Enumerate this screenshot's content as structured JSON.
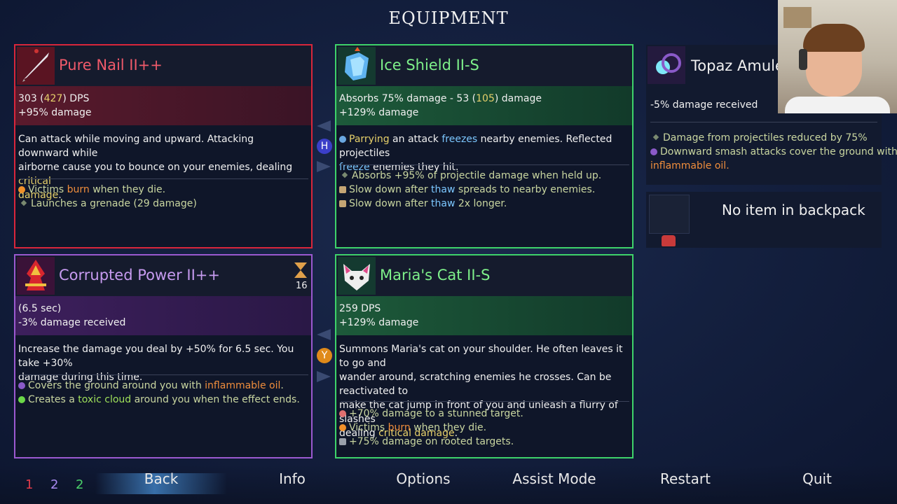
{
  "screen_title": "EQUIPMENT",
  "colors": {
    "red": "#d9263b",
    "green": "#3ed36a",
    "purple": "#9b59d0"
  },
  "cards": {
    "weapon1": {
      "name": "Pure Nail II++",
      "stat1_a": "303 (",
      "stat1_b": "427",
      "stat1_c": ") DPS",
      "stat2": "+95% damage",
      "desc_line1": "Can attack while moving and upward. Attacking downward while",
      "desc_line2a": "airborne cause you to bounce on your enemies, dealing ",
      "desc_line2b": "critical",
      "desc_line3": "damage",
      "desc_line3_end": ".",
      "b1_a": "Victims ",
      "b1_b": "burn",
      "b1_c": " when they die.",
      "b2": "Launches a grenade (29 damage)"
    },
    "shield": {
      "name": "Ice Shield II-S",
      "stat1_a": "Absorbs 75% damage - 53 (",
      "stat1_b": "105",
      "stat1_c": ") damage",
      "stat2": "+129% damage",
      "d1a": "Parrying",
      "d1b": " an attack ",
      "d1c": "freezes",
      "d1d": " nearby enemies. Reflected projectiles",
      "d2a": "freeze",
      "d2b": " enemies they hit.",
      "b1": "Absorbs +95% of projectile damage when held up.",
      "b2_a": "Slow down after ",
      "b2_b": "thaw",
      "b2_c": " spreads to nearby enemies.",
      "b3_a": "Slow down after ",
      "b3_b": "thaw",
      "b3_c": " 2x longer."
    },
    "skill": {
      "name": "Corrupted Power II++",
      "cooldown_count": "16",
      "stat1": "(6.5 sec)",
      "stat2": "-3% damage received",
      "desc_line1": "Increase the damage you deal by +50% for 6.5 sec. You take +30%",
      "desc_line2": "damage during this time.",
      "b1_a": "Covers the ground around you with ",
      "b1_b": "inflammable oil",
      "b1_c": ".",
      "b2_a": "Creates a ",
      "b2_b": "toxic cloud",
      "b2_c": " around you when the effect ends."
    },
    "cat": {
      "name": "Maria's Cat II-S",
      "stat1": "259 DPS",
      "stat2": "+129% damage",
      "desc_line1": "Summons Maria's cat on your shoulder. He often leaves it to go and",
      "desc_line2": "wander around, scratching enemies he crosses. Can be reactivated to",
      "desc_line3": "make the cat jump in front of you and unleash a flurry of slashes",
      "desc_line4a": "dealing ",
      "desc_line4b": "critical damage",
      "desc_line4c": ".",
      "b1": "+70% damage to a stunned target.",
      "b2_a": "Victims ",
      "b2_b": "burn",
      "b2_c": " when they die.",
      "b3": "+75% damage on rooted targets."
    },
    "amulet": {
      "name": "Topaz Amulet",
      "stat1": "-5% damage received",
      "b1": "Damage from projectiles reduced by 75%",
      "b2": "Downward smash attacks cover the ground with",
      "b3": "inflammable oil."
    }
  },
  "swap_keys": {
    "top": "H",
    "bottom": "Y"
  },
  "backpack": {
    "empty_text": "No item in backpack"
  },
  "stats": {
    "brutality": "1",
    "tactics": "2",
    "survival": "2"
  },
  "nav": {
    "back": "Back",
    "info": "Info",
    "options": "Options",
    "assist": "Assist Mode",
    "restart": "Restart",
    "quit": "Quit"
  }
}
